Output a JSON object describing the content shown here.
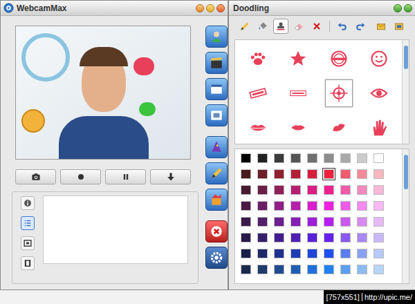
{
  "webcam_window": {
    "title": "WebcamMax"
  },
  "doodle_window": {
    "title": "Doodling"
  },
  "capture_buttons": [
    {
      "kind": "snapshot"
    },
    {
      "kind": "record"
    },
    {
      "kind": "pause"
    },
    {
      "kind": "download"
    }
  ],
  "side_tools": [
    {
      "kind": "people"
    },
    {
      "kind": "clips"
    },
    {
      "kind": "frame"
    },
    {
      "kind": "scene"
    },
    {
      "kind": "magic"
    },
    {
      "kind": "draw"
    },
    {
      "kind": "effects"
    },
    {
      "kind": "close"
    },
    {
      "kind": "settings"
    }
  ],
  "panel_tabs": [
    {
      "kind": "info",
      "selected": false
    },
    {
      "kind": "list",
      "selected": true
    },
    {
      "kind": "image",
      "selected": false
    },
    {
      "kind": "film",
      "selected": false
    }
  ],
  "doodle_tools": [
    {
      "kind": "pencil",
      "selected": false
    },
    {
      "kind": "fill",
      "selected": false
    },
    {
      "kind": "stamp",
      "selected": true
    },
    {
      "kind": "eraser",
      "selected": false
    },
    {
      "kind": "clear",
      "selected": false
    },
    {
      "kind": "undo",
      "selected": false
    },
    {
      "kind": "redo",
      "selected": false
    },
    {
      "kind": "open",
      "selected": false
    },
    {
      "kind": "save",
      "selected": false
    }
  ],
  "stamps": [
    {
      "kind": "paw",
      "selected": false
    },
    {
      "kind": "star",
      "selected": false
    },
    {
      "kind": "badge",
      "selected": false
    },
    {
      "kind": "smiley",
      "selected": false
    },
    {
      "kind": "crime",
      "selected": false
    },
    {
      "kind": "official",
      "selected": false
    },
    {
      "kind": "target",
      "selected": true
    },
    {
      "kind": "eye",
      "selected": false
    },
    {
      "kind": "lips",
      "selected": false
    },
    {
      "kind": "kiss",
      "selected": false
    },
    {
      "kind": "pout",
      "selected": false
    },
    {
      "kind": "hand",
      "selected": false
    }
  ],
  "palette": [
    [
      {
        "color": "#000000",
        "selected": false
      },
      {
        "color": "#222222",
        "selected": false
      },
      {
        "color": "#3a3a3a",
        "selected": false
      },
      {
        "color": "#555555",
        "selected": false
      },
      {
        "color": "#707070",
        "selected": false
      },
      {
        "color": "#8c8c8c",
        "selected": false
      },
      {
        "color": "#aaaaaa",
        "selected": false
      },
      {
        "color": "#cccccc",
        "selected": false
      },
      {
        "color": "#ffffff",
        "selected": false
      }
    ],
    [
      {
        "color": "#4a1a1f",
        "selected": false
      },
      {
        "color": "#6b1f2a",
        "selected": false
      },
      {
        "color": "#8f1f2f",
        "selected": false
      },
      {
        "color": "#b31f38",
        "selected": false
      },
      {
        "color": "#d61f3c",
        "selected": false
      },
      {
        "color": "#f0203f",
        "selected": true
      },
      {
        "color": "#f05a70",
        "selected": false
      },
      {
        "color": "#f28a9a",
        "selected": false
      },
      {
        "color": "#f7b8c2",
        "selected": false
      }
    ],
    [
      {
        "color": "#4a1a30",
        "selected": false
      },
      {
        "color": "#6b1f45",
        "selected": false
      },
      {
        "color": "#901f5a",
        "selected": false
      },
      {
        "color": "#b51f70",
        "selected": false
      },
      {
        "color": "#d91f85",
        "selected": false
      },
      {
        "color": "#f02090",
        "selected": false
      },
      {
        "color": "#f05aa8",
        "selected": false
      },
      {
        "color": "#f28ac0",
        "selected": false
      },
      {
        "color": "#f7b8d8",
        "selected": false
      }
    ],
    [
      {
        "color": "#4a1a45",
        "selected": false
      },
      {
        "color": "#6b1f65",
        "selected": false
      },
      {
        "color": "#901f88",
        "selected": false
      },
      {
        "color": "#b51faa",
        "selected": false
      },
      {
        "color": "#d91fcc",
        "selected": false
      },
      {
        "color": "#f020e0",
        "selected": false
      },
      {
        "color": "#f05ae8",
        "selected": false
      },
      {
        "color": "#f28aef",
        "selected": false
      },
      {
        "color": "#f7b8f5",
        "selected": false
      }
    ],
    [
      {
        "color": "#3a1a4a",
        "selected": false
      },
      {
        "color": "#521f6b",
        "selected": false
      },
      {
        "color": "#6b1f90",
        "selected": false
      },
      {
        "color": "#851fb5",
        "selected": false
      },
      {
        "color": "#9f1fd9",
        "selected": false
      },
      {
        "color": "#b520f0",
        "selected": false
      },
      {
        "color": "#c85af0",
        "selected": false
      },
      {
        "color": "#d88af2",
        "selected": false
      },
      {
        "color": "#e8b8f7",
        "selected": false
      }
    ],
    [
      {
        "color": "#2a1a4a",
        "selected": false
      },
      {
        "color": "#351f6b",
        "selected": false
      },
      {
        "color": "#421f90",
        "selected": false
      },
      {
        "color": "#4e1fb5",
        "selected": false
      },
      {
        "color": "#5a1fd9",
        "selected": false
      },
      {
        "color": "#6620f0",
        "selected": false
      },
      {
        "color": "#8a5af0",
        "selected": false
      },
      {
        "color": "#a88af2",
        "selected": false
      },
      {
        "color": "#c8b8f7",
        "selected": false
      }
    ],
    [
      {
        "color": "#1a1f4a",
        "selected": false
      },
      {
        "color": "#1f286b",
        "selected": false
      },
      {
        "color": "#1f3290",
        "selected": false
      },
      {
        "color": "#1f3cb5",
        "selected": false
      },
      {
        "color": "#1f46d9",
        "selected": false
      },
      {
        "color": "#2050f0",
        "selected": false
      },
      {
        "color": "#5a7ef0",
        "selected": false
      },
      {
        "color": "#8aa2f2",
        "selected": false
      },
      {
        "color": "#b8c8f7",
        "selected": false
      }
    ],
    [
      {
        "color": "#1a2a4a",
        "selected": false
      },
      {
        "color": "#1f3a6b",
        "selected": false
      },
      {
        "color": "#1f4c90",
        "selected": false
      },
      {
        "color": "#1f5eb5",
        "selected": false
      },
      {
        "color": "#1f70d9",
        "selected": false
      },
      {
        "color": "#2082f0",
        "selected": false
      },
      {
        "color": "#5aa0f0",
        "selected": false
      },
      {
        "color": "#8abcf2",
        "selected": false
      },
      {
        "color": "#b8d6f7",
        "selected": false
      }
    ]
  ],
  "watermark": {
    "size": "[757x551]",
    "url": "http://upic.me/"
  }
}
